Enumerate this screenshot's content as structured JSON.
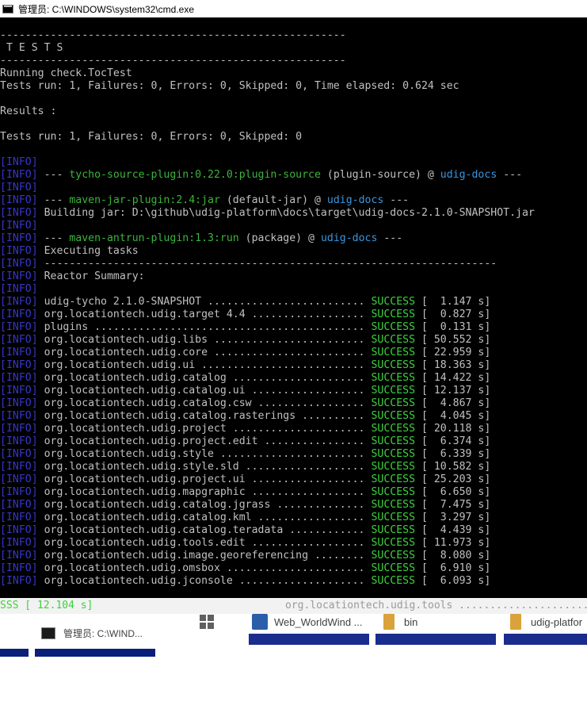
{
  "window": {
    "title": "管理员: C:\\WINDOWS\\system32\\cmd.exe",
    "icon": "cmd-icon"
  },
  "console": {
    "lines": [
      {
        "segments": [
          {
            "t": "-------------------------------------------------------",
            "c": "plain"
          }
        ]
      },
      {
        "segments": [
          {
            "t": " T E S T S",
            "c": "plain"
          }
        ]
      },
      {
        "segments": [
          {
            "t": "-------------------------------------------------------",
            "c": "plain"
          }
        ]
      },
      {
        "segments": [
          {
            "t": "Running check.TocTest",
            "c": "plain"
          }
        ]
      },
      {
        "segments": [
          {
            "t": "Tests run: 1, Failures: 0, Errors: 0, Skipped: 0, Time elapsed: 0.624 sec",
            "c": "plain"
          }
        ]
      },
      {
        "segments": [
          {
            "t": "",
            "c": "plain"
          }
        ]
      },
      {
        "segments": [
          {
            "t": "Results :",
            "c": "plain"
          }
        ]
      },
      {
        "segments": [
          {
            "t": "",
            "c": "plain"
          }
        ]
      },
      {
        "segments": [
          {
            "t": "Tests run: 1, Failures: 0, Errors: 0, Skipped: 0",
            "c": "plain"
          }
        ]
      },
      {
        "segments": [
          {
            "t": "",
            "c": "plain"
          }
        ]
      },
      {
        "segments": [
          {
            "t": "[INFO]",
            "c": "info"
          }
        ]
      },
      {
        "segments": [
          {
            "t": "[INFO]",
            "c": "info"
          },
          {
            "t": " --- ",
            "c": "plain"
          },
          {
            "t": "tycho-source-plugin:0.22.0:plugin-source",
            "c": "plug"
          },
          {
            "t": " (plugin-source) @ ",
            "c": "plain"
          },
          {
            "t": "udig-docs",
            "c": "teal"
          },
          {
            "t": " ---",
            "c": "plain"
          }
        ]
      },
      {
        "segments": [
          {
            "t": "[INFO]",
            "c": "info"
          }
        ]
      },
      {
        "segments": [
          {
            "t": "[INFO]",
            "c": "info"
          },
          {
            "t": " --- ",
            "c": "plain"
          },
          {
            "t": "maven-jar-plugin:2.4:jar",
            "c": "plug"
          },
          {
            "t": " (default-jar) @ ",
            "c": "plain"
          },
          {
            "t": "udig-docs",
            "c": "teal"
          },
          {
            "t": " ---",
            "c": "plain"
          }
        ]
      },
      {
        "segments": [
          {
            "t": "[INFO]",
            "c": "info"
          },
          {
            "t": " Building jar: D:\\github\\udig-platform\\docs\\target\\udig-docs-2.1.0-SNAPSHOT.jar",
            "c": "plain"
          }
        ]
      },
      {
        "segments": [
          {
            "t": "[INFO]",
            "c": "info"
          }
        ]
      },
      {
        "segments": [
          {
            "t": "[INFO]",
            "c": "info"
          },
          {
            "t": " --- ",
            "c": "plain"
          },
          {
            "t": "maven-antrun-plugin:1.3:run",
            "c": "plug"
          },
          {
            "t": " (package) @ ",
            "c": "plain"
          },
          {
            "t": "udig-docs",
            "c": "teal"
          },
          {
            "t": " ---",
            "c": "plain"
          }
        ]
      },
      {
        "segments": [
          {
            "t": "[INFO]",
            "c": "info"
          },
          {
            "t": " Executing tasks",
            "c": "plain"
          }
        ]
      },
      {
        "segments": [
          {
            "t": "[INFO]",
            "c": "info"
          },
          {
            "t": " ------------------------------------------------------------------------",
            "c": "plain"
          }
        ]
      },
      {
        "segments": [
          {
            "t": "[INFO]",
            "c": "info"
          },
          {
            "t": " Reactor Summary:",
            "c": "plain"
          }
        ]
      },
      {
        "segments": [
          {
            "t": "[INFO]",
            "c": "info"
          }
        ]
      },
      {
        "segments": [
          {
            "t": "[INFO]",
            "c": "info"
          },
          {
            "t": " udig-tycho 2.1.0-SNAPSHOT ......................... ",
            "c": "plain"
          },
          {
            "t": "SUCCESS",
            "c": "green"
          },
          {
            "t": " [  1.147 s]",
            "c": "plain"
          }
        ]
      },
      {
        "segments": [
          {
            "t": "[INFO]",
            "c": "info"
          },
          {
            "t": " org.locationtech.udig.target 4.4 .................. ",
            "c": "plain"
          },
          {
            "t": "SUCCESS",
            "c": "green"
          },
          {
            "t": " [  0.827 s]",
            "c": "plain"
          }
        ]
      },
      {
        "segments": [
          {
            "t": "[INFO]",
            "c": "info"
          },
          {
            "t": " plugins ........................................... ",
            "c": "plain"
          },
          {
            "t": "SUCCESS",
            "c": "green"
          },
          {
            "t": " [  0.131 s]",
            "c": "plain"
          }
        ]
      },
      {
        "segments": [
          {
            "t": "[INFO]",
            "c": "info"
          },
          {
            "t": " org.locationtech.udig.libs ........................ ",
            "c": "plain"
          },
          {
            "t": "SUCCESS",
            "c": "green"
          },
          {
            "t": " [ 50.552 s]",
            "c": "plain"
          }
        ]
      },
      {
        "segments": [
          {
            "t": "[INFO]",
            "c": "info"
          },
          {
            "t": " org.locationtech.udig.core ........................ ",
            "c": "plain"
          },
          {
            "t": "SUCCESS",
            "c": "green"
          },
          {
            "t": " [ 22.959 s]",
            "c": "plain"
          }
        ]
      },
      {
        "segments": [
          {
            "t": "[INFO]",
            "c": "info"
          },
          {
            "t": " org.locationtech.udig.ui .......................... ",
            "c": "plain"
          },
          {
            "t": "SUCCESS",
            "c": "green"
          },
          {
            "t": " [ 18.363 s]",
            "c": "plain"
          }
        ]
      },
      {
        "segments": [
          {
            "t": "[INFO]",
            "c": "info"
          },
          {
            "t": " org.locationtech.udig.catalog ..................... ",
            "c": "plain"
          },
          {
            "t": "SUCCESS",
            "c": "green"
          },
          {
            "t": " [ 14.422 s]",
            "c": "plain"
          }
        ]
      },
      {
        "segments": [
          {
            "t": "[INFO]",
            "c": "info"
          },
          {
            "t": " org.locationtech.udig.catalog.ui .................. ",
            "c": "plain"
          },
          {
            "t": "SUCCESS",
            "c": "green"
          },
          {
            "t": " [ 12.137 s]",
            "c": "plain"
          }
        ]
      },
      {
        "segments": [
          {
            "t": "[INFO]",
            "c": "info"
          },
          {
            "t": " org.locationtech.udig.catalog.csw ................. ",
            "c": "plain"
          },
          {
            "t": "SUCCESS",
            "c": "green"
          },
          {
            "t": " [  4.867 s]",
            "c": "plain"
          }
        ]
      },
      {
        "segments": [
          {
            "t": "[INFO]",
            "c": "info"
          },
          {
            "t": " org.locationtech.udig.catalog.rasterings .......... ",
            "c": "plain"
          },
          {
            "t": "SUCCESS",
            "c": "green"
          },
          {
            "t": " [  4.045 s]",
            "c": "plain"
          }
        ]
      },
      {
        "segments": [
          {
            "t": "[INFO]",
            "c": "info"
          },
          {
            "t": " org.locationtech.udig.project ..................... ",
            "c": "plain"
          },
          {
            "t": "SUCCESS",
            "c": "green"
          },
          {
            "t": " [ 20.118 s]",
            "c": "plain"
          }
        ]
      },
      {
        "segments": [
          {
            "t": "[INFO]",
            "c": "info"
          },
          {
            "t": " org.locationtech.udig.project.edit ................ ",
            "c": "plain"
          },
          {
            "t": "SUCCESS",
            "c": "green"
          },
          {
            "t": " [  6.374 s]",
            "c": "plain"
          }
        ]
      },
      {
        "segments": [
          {
            "t": "[INFO]",
            "c": "info"
          },
          {
            "t": " org.locationtech.udig.style ....................... ",
            "c": "plain"
          },
          {
            "t": "SUCCESS",
            "c": "green"
          },
          {
            "t": " [  6.339 s]",
            "c": "plain"
          }
        ]
      },
      {
        "segments": [
          {
            "t": "[INFO]",
            "c": "info"
          },
          {
            "t": " org.locationtech.udig.style.sld ................... ",
            "c": "plain"
          },
          {
            "t": "SUCCESS",
            "c": "green"
          },
          {
            "t": " [ 10.582 s]",
            "c": "plain"
          }
        ]
      },
      {
        "segments": [
          {
            "t": "[INFO]",
            "c": "info"
          },
          {
            "t": " org.locationtech.udig.project.ui .................. ",
            "c": "plain"
          },
          {
            "t": "SUCCESS",
            "c": "green"
          },
          {
            "t": " [ 25.203 s]",
            "c": "plain"
          }
        ]
      },
      {
        "segments": [
          {
            "t": "[INFO]",
            "c": "info"
          },
          {
            "t": " org.locationtech.udig.mapgraphic .................. ",
            "c": "plain"
          },
          {
            "t": "SUCCESS",
            "c": "green"
          },
          {
            "t": " [  6.650 s]",
            "c": "plain"
          }
        ]
      },
      {
        "segments": [
          {
            "t": "[INFO]",
            "c": "info"
          },
          {
            "t": " org.locationtech.udig.catalog.jgrass .............. ",
            "c": "plain"
          },
          {
            "t": "SUCCESS",
            "c": "green"
          },
          {
            "t": " [  7.475 s]",
            "c": "plain"
          }
        ]
      },
      {
        "segments": [
          {
            "t": "[INFO]",
            "c": "info"
          },
          {
            "t": " org.locationtech.udig.catalog.kml ................. ",
            "c": "plain"
          },
          {
            "t": "SUCCESS",
            "c": "green"
          },
          {
            "t": " [  3.297 s]",
            "c": "plain"
          }
        ]
      },
      {
        "segments": [
          {
            "t": "[INFO]",
            "c": "info"
          },
          {
            "t": " org.locationtech.udig.catalog.teradata ............ ",
            "c": "plain"
          },
          {
            "t": "SUCCESS",
            "c": "green"
          },
          {
            "t": " [  4.439 s]",
            "c": "plain"
          }
        ]
      },
      {
        "segments": [
          {
            "t": "[INFO]",
            "c": "info"
          },
          {
            "t": " org.locationtech.udig.tools.edit .................. ",
            "c": "plain"
          },
          {
            "t": "SUCCESS",
            "c": "green"
          },
          {
            "t": " [ 11.973 s]",
            "c": "plain"
          }
        ]
      },
      {
        "segments": [
          {
            "t": "[INFO]",
            "c": "info"
          },
          {
            "t": " org.locationtech.udig.image.georeferencing ........ ",
            "c": "plain"
          },
          {
            "t": "SUCCESS",
            "c": "green"
          },
          {
            "t": " [  8.080 s]",
            "c": "plain"
          }
        ]
      },
      {
        "segments": [
          {
            "t": "[INFO]",
            "c": "info"
          },
          {
            "t": " org.locationtech.udig.omsbox ...................... ",
            "c": "plain"
          },
          {
            "t": "SUCCESS",
            "c": "green"
          },
          {
            "t": " [  6.910 s]",
            "c": "plain"
          }
        ]
      },
      {
        "segments": [
          {
            "t": "[INFO]",
            "c": "info"
          },
          {
            "t": " org.locationtech.udig.jconsole .................... ",
            "c": "plain"
          },
          {
            "t": "SUCCESS",
            "c": "green"
          },
          {
            "t": " [  6.093 s]",
            "c": "plain"
          }
        ]
      }
    ]
  },
  "taskbar": {
    "overflow_line": "SSS [ 12.104 s]",
    "ghost_line": "org.locationtech.udig.tools ......................",
    "items": [
      {
        "label": "",
        "icon": "windows-start-icon"
      },
      {
        "label": "Web_WorldWind ...",
        "icon": "webstorm-icon"
      },
      {
        "label": "bin",
        "icon": "folder-icon"
      },
      {
        "label": "udig-platfor",
        "icon": "folder-icon"
      }
    ],
    "cmd_item": {
      "label": "管理员: C:\\WIND...",
      "icon": "cmd-icon"
    }
  },
  "colors": {
    "info": "#3737c8",
    "success": "#3cd23c",
    "plugin": "#3cb43c",
    "module": "#3a96dd",
    "console_bg": "#000000",
    "console_fg": "#c0c0c0"
  }
}
